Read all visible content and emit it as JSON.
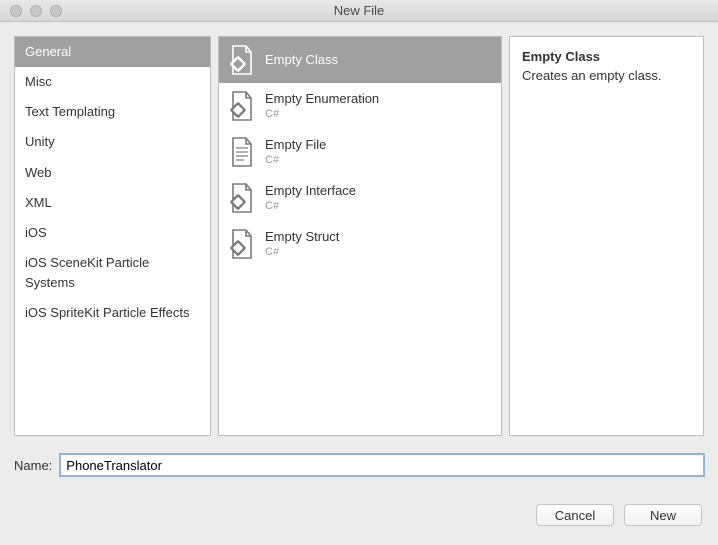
{
  "window": {
    "title": "New File"
  },
  "categories": [
    {
      "label": "General",
      "selected": true
    },
    {
      "label": "Misc"
    },
    {
      "label": "Text Templating"
    },
    {
      "label": "Unity"
    },
    {
      "label": "Web"
    },
    {
      "label": "XML"
    },
    {
      "label": "iOS"
    },
    {
      "label": "iOS SceneKit Particle Systems"
    },
    {
      "label": "iOS SpriteKit Particle Effects"
    }
  ],
  "templates": [
    {
      "label": "Empty Class",
      "sub": "",
      "selected": true,
      "icon": "class"
    },
    {
      "label": "Empty Enumeration",
      "sub": "C#",
      "icon": "class"
    },
    {
      "label": "Empty File",
      "sub": "C#",
      "icon": "file"
    },
    {
      "label": "Empty Interface",
      "sub": "C#",
      "icon": "class"
    },
    {
      "label": "Empty Struct",
      "sub": "C#",
      "icon": "class"
    }
  ],
  "description": {
    "title": "Empty Class",
    "body": "Creates an empty class."
  },
  "name": {
    "label": "Name:",
    "value": "PhoneTranslator"
  },
  "buttons": {
    "cancel": "Cancel",
    "new": "New"
  }
}
